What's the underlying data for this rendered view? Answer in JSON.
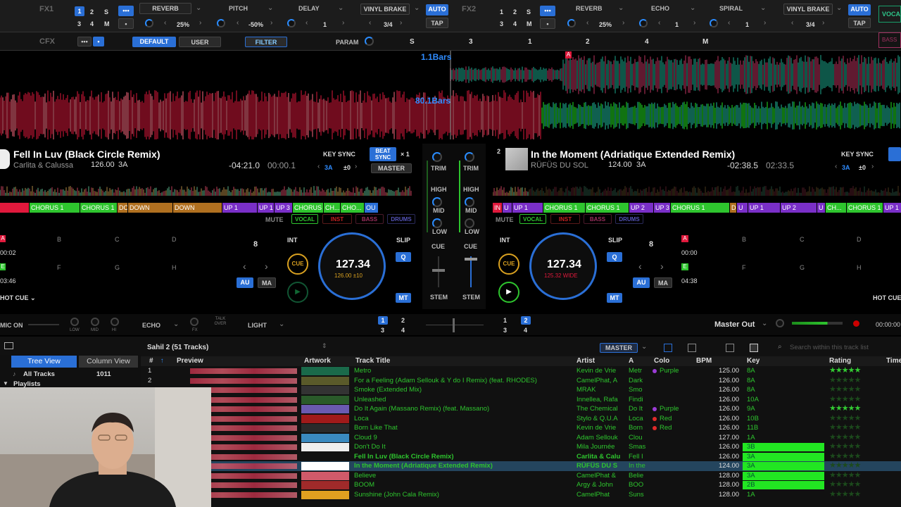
{
  "fx1": {
    "label": "FX1",
    "slots": [
      {
        "name": "REVERB",
        "value": "25%"
      },
      {
        "name": "PITCH",
        "value": "-50%"
      },
      {
        "name": "DELAY",
        "value": "1"
      },
      {
        "name": "VINYL BRAKE",
        "value": "3/4"
      }
    ],
    "beats": [
      "1",
      "2",
      "S",
      "3",
      "4",
      "M"
    ],
    "auto": "AUTO",
    "tap": "TAP"
  },
  "fx2": {
    "label": "FX2",
    "slots": [
      {
        "name": "REVERB",
        "value": "25%"
      },
      {
        "name": "ECHO",
        "value": "1"
      },
      {
        "name": "SPIRAL",
        "value": "1"
      },
      {
        "name": "VINYL BRAKE",
        "value": "3/4"
      }
    ],
    "beats": [
      "1",
      "2",
      "S",
      "3",
      "4",
      "M"
    ],
    "auto": "AUTO",
    "tap": "TAP",
    "vocal": "VOCAL",
    "bass": "BASS"
  },
  "cfx": {
    "label": "CFX",
    "default": "DEFAULT",
    "user": "USER",
    "filter": "FILTER",
    "param": "PARAM",
    "steps": [
      "S",
      "3",
      "1",
      "2",
      "4",
      "M"
    ]
  },
  "wave": {
    "bars_top": "1.1Bars",
    "bars_bottom": "80.1Bars",
    "marker": "A"
  },
  "deck1": {
    "num": "1",
    "title": "Fell In Luv (Black Circle Remix)",
    "artist": "Carlita & Calussa",
    "bpm": "126.00",
    "key": "3A",
    "remain": "-04:21.0",
    "elapsed": "00:00.1",
    "keysync": "KEY SYNC",
    "key_small": "3A",
    "key_off": "±0",
    "beatsync": "BEAT SYNC",
    "x": "× 1",
    "master": "MASTER",
    "phrases": [
      "CHORUS 1",
      "CHORUS 1",
      "DO",
      "DOWN",
      "DOWN",
      "UP 1",
      "UP 1",
      "UP 3",
      "CHORUS 1",
      "CH...",
      "CHO...",
      "OU"
    ],
    "mute": "MUTE",
    "stems": [
      "VOCAL",
      "INST",
      "BASS",
      "DRUMS"
    ],
    "pads": [
      "A",
      "B",
      "C",
      "D",
      "E",
      "F",
      "G",
      "H"
    ],
    "pad_times": [
      "00:02",
      "03:46"
    ],
    "hotcue": "HOT CUE",
    "loop": "8",
    "int": "INT",
    "cue": "CUE",
    "au": "AU",
    "ma": "MA",
    "slip": "SLIP",
    "q": "Q",
    "mt": "MT",
    "jog_bpm": "127.34",
    "jog_sub": "126.00 ±10"
  },
  "deck2": {
    "num": "2",
    "title": "In the Moment (Adriatique Extended Remix)",
    "artist": "RÜFÜS DU SOL",
    "bpm": "124.00",
    "key": "3A",
    "remain": "-02:38.5",
    "elapsed": "02:33.5",
    "keysync": "KEY SYNC",
    "key_small": "3A",
    "key_off": "±0",
    "phrases": [
      "IN",
      "U",
      "UP 1",
      "CHORUS 1",
      "CHORUS 1",
      "UP 2",
      "UP 3",
      "CHORUS 1",
      "D",
      "U",
      "UP 1",
      "UP 2",
      "U",
      "CH...",
      "CHORUS 1",
      "UP 1"
    ],
    "mute": "MUTE",
    "stems": [
      "VOCAL",
      "INST",
      "BASS",
      "DRUMS"
    ],
    "pads": [
      "A",
      "B",
      "C",
      "D",
      "E",
      "F",
      "G",
      "H"
    ],
    "pad_times": [
      "00:00",
      "04:38"
    ],
    "hotcue": "HOT CUE",
    "loop": "8",
    "int": "INT",
    "cue": "CUE",
    "au": "AU",
    "ma": "MA",
    "slip": "SLIP",
    "q": "Q",
    "mt": "MT",
    "jog_bpm": "127.34",
    "jog_sub": "125.32 WIDE"
  },
  "mixer": {
    "trim": "TRIM",
    "high": "HIGH",
    "mid": "MID",
    "low": "LOW",
    "cue": "CUE",
    "stem": "STEM"
  },
  "bottom": {
    "mic": "MIC ON",
    "low": "LOW",
    "mid": "MID",
    "hi": "HI",
    "echo": "ECHO",
    "fx": "FX",
    "talkover": "TALK OVER",
    "light": "LIGHT",
    "decks1": [
      "1",
      "2",
      "3",
      "4"
    ],
    "decks2": [
      "1",
      "2",
      "3",
      "4"
    ],
    "master_out": "Master Out",
    "clock": "00:00:00"
  },
  "browser": {
    "playlist": "Sahil 2 (51 Tracks)",
    "master": "MASTER",
    "search": "Search within this track list",
    "tree": "Tree View",
    "column": "Column View",
    "all_tracks": "All Tracks",
    "all_count": "1011",
    "playlists": "Playlists",
    "headers": {
      "num": "#",
      "preview": "Preview",
      "artwork": "Artwork",
      "title": "Track Title",
      "artist": "Artist",
      "a": "A",
      "color": "Colo",
      "bpm": "BPM",
      "key": "Key",
      "rating": "Rating",
      "time": "Time"
    },
    "rows": [
      {
        "n": "1",
        "title": "Metro",
        "artist": "Kevin de Vrie",
        "album": "Metr",
        "color": "Purple",
        "bpm": "125.00",
        "key": "8A",
        "stars": 5
      },
      {
        "n": "2",
        "title": "For a Feeling (Adam Sellouk & Y do I Remix) (feat. RHODES)",
        "artist": "CamelPhat, A",
        "album": "Dark",
        "color": "",
        "bpm": "126.00",
        "key": "8A",
        "stars": 0
      },
      {
        "n": "",
        "title": "Smoke (Extended Mix)",
        "artist": "MRAK",
        "album": "Smo",
        "color": "",
        "bpm": "126.00",
        "key": "8A",
        "stars": 0
      },
      {
        "n": "",
        "title": "Unleashed",
        "artist": "Innellea, Rafa",
        "album": "Findi",
        "color": "",
        "bpm": "126.00",
        "key": "10A",
        "stars": 0
      },
      {
        "n": "",
        "title": "Do It Again (Massano Remix) (feat. Massano)",
        "artist": "The Chemical",
        "album": "Do It",
        "color": "Purple",
        "bpm": "126.00",
        "key": "9A",
        "stars": 5
      },
      {
        "n": "",
        "title": "Loca",
        "artist": "Stylo & Q.U.A",
        "album": "Loca",
        "color": "Red",
        "bpm": "126.00",
        "key": "10B",
        "stars": 0
      },
      {
        "n": "",
        "title": "Born Like That",
        "artist": "Kevin de Vrie",
        "album": "Born",
        "color": "Red",
        "bpm": "126.00",
        "key": "11B",
        "stars": 0
      },
      {
        "n": "",
        "title": "Cloud 9",
        "artist": "Adam Sellouk",
        "album": "Clou",
        "color": "",
        "bpm": "127.00",
        "key": "1A",
        "stars": 0
      },
      {
        "n": "",
        "title": "Don't Do It",
        "artist": "Mila Journée",
        "album": "Smas",
        "color": "",
        "bpm": "126.00",
        "key": "3B",
        "stars": 0
      },
      {
        "n": "",
        "title": "Fell In Luv (Black Circle Remix)",
        "artist": "Carlita & Calu",
        "album": "Fell I",
        "color": "",
        "bpm": "126.00",
        "key": "3A",
        "stars": 0
      },
      {
        "n": "",
        "title": "In the Moment (Adriatique Extended Remix)",
        "artist": "RÜFÜS DU S",
        "album": "In the",
        "color": "",
        "bpm": "124.00",
        "key": "3A",
        "stars": 0
      },
      {
        "n": "",
        "title": "Believe",
        "artist": "CamelPhat &",
        "album": "Belie",
        "color": "",
        "bpm": "128.00",
        "key": "3A",
        "stars": 0
      },
      {
        "n": "",
        "title": "BOOM",
        "artist": "Argy & John",
        "album": "BOO",
        "color": "",
        "bpm": "128.00",
        "key": "2B",
        "stars": 0
      },
      {
        "n": "",
        "title": "Sunshine (John Cala Remix)",
        "artist": "CamelPhat",
        "album": "Suns",
        "color": "",
        "bpm": "128.00",
        "key": "1A",
        "stars": 0
      }
    ]
  },
  "colors": {
    "accent": "#2a6fd6",
    "green": "#2ec52e",
    "lime": "#22e622",
    "wave_red": "#e0193c",
    "wave_teal": "#1fbf9f",
    "purple": "#9b3cd6",
    "red": "#e02a2a"
  }
}
